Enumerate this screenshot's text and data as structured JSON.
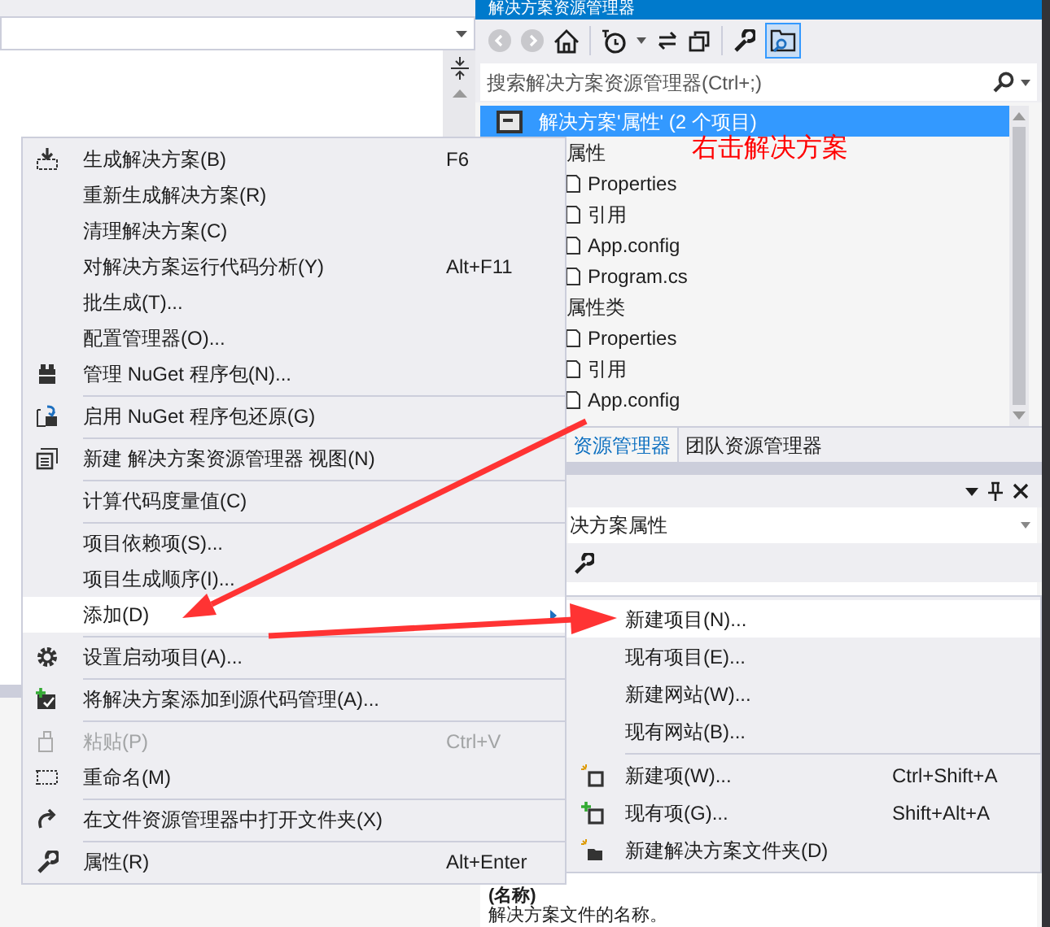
{
  "solution_explorer": {
    "title": "解决方案资源管理器",
    "search": {
      "placeholder": "搜索解决方案资源管理器(Ctrl+;)"
    },
    "tree": [
      {
        "label": "解决方案'属性' (2 个项目)",
        "selected": true,
        "children": [
          {
            "label": "属性",
            "selected": false,
            "children": [
              {
                "label": "Properties",
                "selected": false
              },
              {
                "label": "引用",
                "selected": false
              },
              {
                "label": "App.config",
                "selected": false
              },
              {
                "label": "Program.cs",
                "selected": false
              }
            ]
          },
          {
            "label": "属性类",
            "selected": false,
            "children": [
              {
                "label": "Properties",
                "selected": false
              },
              {
                "label": "引用",
                "selected": false
              },
              {
                "label": "App.config",
                "selected": false
              }
            ]
          }
        ]
      }
    ],
    "tabs": [
      {
        "label": "资源管理器",
        "selected": true
      },
      {
        "label": "团队资源管理器",
        "selected": false
      }
    ]
  },
  "annotation": {
    "text": "右击解决方案"
  },
  "properties_panel": {
    "object": "决方案属性",
    "property_name": "(名称)",
    "description": "解决方案文件的名称。"
  },
  "context_menu": {
    "items": [
      {
        "kind": "item",
        "label": "生成解决方案(B)",
        "shortcut": "F6",
        "disabled": false,
        "highlighted": false,
        "submenu": false
      },
      {
        "kind": "item",
        "label": "重新生成解决方案(R)",
        "disabled": false,
        "highlighted": false,
        "submenu": false
      },
      {
        "kind": "item",
        "label": "清理解决方案(C)",
        "disabled": false,
        "highlighted": false,
        "submenu": false
      },
      {
        "kind": "item",
        "label": "对解决方案运行代码分析(Y)",
        "shortcut": "Alt+F11",
        "disabled": false,
        "highlighted": false,
        "submenu": false
      },
      {
        "kind": "item",
        "label": "批生成(T)...",
        "disabled": false,
        "highlighted": false,
        "submenu": false
      },
      {
        "kind": "item",
        "label": "配置管理器(O)...",
        "disabled": false,
        "highlighted": false,
        "submenu": false
      },
      {
        "kind": "item",
        "label": "管理 NuGet 程序包(N)...",
        "disabled": false,
        "highlighted": false,
        "submenu": false
      },
      {
        "kind": "separator"
      },
      {
        "kind": "item",
        "label": "启用 NuGet 程序包还原(G)",
        "disabled": false,
        "highlighted": false,
        "submenu": false
      },
      {
        "kind": "separator"
      },
      {
        "kind": "item",
        "label": "新建 解决方案资源管理器 视图(N)",
        "disabled": false,
        "highlighted": false,
        "submenu": false
      },
      {
        "kind": "separator"
      },
      {
        "kind": "item",
        "label": "计算代码度量值(C)",
        "disabled": false,
        "highlighted": false,
        "submenu": false
      },
      {
        "kind": "separator"
      },
      {
        "kind": "item",
        "label": "项目依赖项(S)...",
        "disabled": false,
        "highlighted": false,
        "submenu": false
      },
      {
        "kind": "item",
        "label": "项目生成顺序(I)...",
        "disabled": false,
        "highlighted": false,
        "submenu": false
      },
      {
        "kind": "item",
        "label": "添加(D)",
        "disabled": false,
        "highlighted": true,
        "submenu": true
      },
      {
        "kind": "separator"
      },
      {
        "kind": "item",
        "label": "设置启动项目(A)...",
        "disabled": false,
        "highlighted": false,
        "submenu": false
      },
      {
        "kind": "separator"
      },
      {
        "kind": "item",
        "label": "将解决方案添加到源代码管理(A)...",
        "disabled": false,
        "highlighted": false,
        "submenu": false
      },
      {
        "kind": "separator"
      },
      {
        "kind": "item",
        "label": "粘贴(P)",
        "shortcut": "Ctrl+V",
        "disabled": true,
        "highlighted": false,
        "submenu": false
      },
      {
        "kind": "item",
        "label": "重命名(M)",
        "disabled": false,
        "highlighted": false,
        "submenu": false
      },
      {
        "kind": "separator"
      },
      {
        "kind": "item",
        "label": "在文件资源管理器中打开文件夹(X)",
        "disabled": false,
        "highlighted": false,
        "submenu": false
      },
      {
        "kind": "separator"
      },
      {
        "kind": "item",
        "label": "属性(R)",
        "shortcut": "Alt+Enter",
        "disabled": false,
        "highlighted": false,
        "submenu": false
      }
    ]
  },
  "submenu": {
    "items": [
      {
        "kind": "item",
        "label": "新建项目(N)...",
        "disabled": false,
        "highlighted": true,
        "submenu": false
      },
      {
        "kind": "item",
        "label": "现有项目(E)...",
        "disabled": false,
        "highlighted": false,
        "submenu": false
      },
      {
        "kind": "item",
        "label": "新建网站(W)...",
        "disabled": false,
        "highlighted": false,
        "submenu": false
      },
      {
        "kind": "item",
        "label": "现有网站(B)...",
        "disabled": false,
        "highlighted": false,
        "submenu": false
      },
      {
        "kind": "separator"
      },
      {
        "kind": "item",
        "label": "新建项(W)...",
        "shortcut": "Ctrl+Shift+A",
        "disabled": false,
        "highlighted": false,
        "submenu": false
      },
      {
        "kind": "item",
        "label": "现有项(G)...",
        "shortcut": "Shift+Alt+A",
        "disabled": false,
        "highlighted": false,
        "submenu": false
      },
      {
        "kind": "item",
        "label": "新建解决方案文件夹(D)",
        "disabled": false,
        "highlighted": false,
        "submenu": false
      }
    ]
  }
}
